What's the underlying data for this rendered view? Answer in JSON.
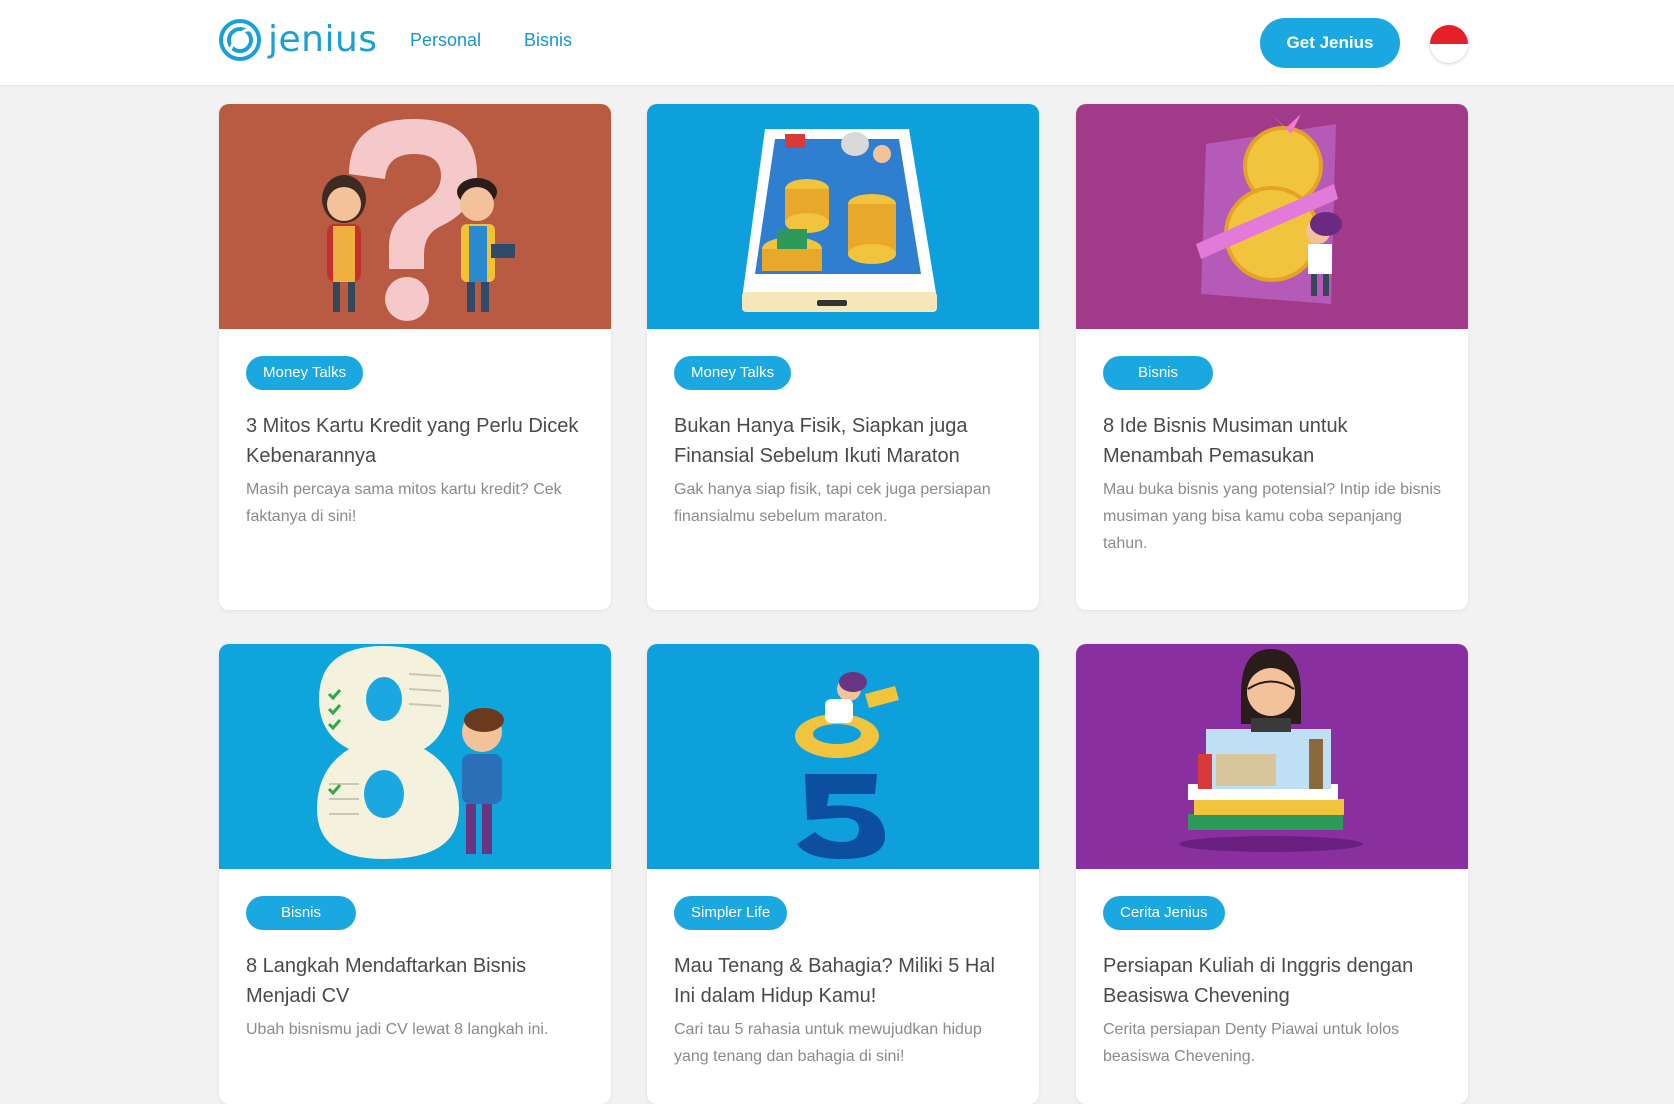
{
  "header": {
    "logo_text": "jenius",
    "nav": {
      "personal": "Personal",
      "bisnis": "Bisnis"
    },
    "cta_label": "Get Jenius",
    "language_flag": "indonesia-flag"
  },
  "colors": {
    "accent": "#1ba7df",
    "card1_bg": "#b95a42",
    "card2_bg": "#0ea0dc",
    "card3_bg": "#a23a8a",
    "card4_bg": "#0ea5dc",
    "card5_bg": "#0ea0dc",
    "card6_bg": "#8a2fa0"
  },
  "cards": [
    {
      "tag": "Money Talks",
      "title": "3 Mitos Kartu Kredit yang Perlu Dicek Kebenarannya",
      "description": "Masih percaya sama mitos kartu kredit? Cek faktanya di sini!"
    },
    {
      "tag": "Money Talks",
      "title": "Bukan Hanya Fisik, Siapkan juga Finansial Sebelum Ikuti Maraton",
      "description": "Gak hanya siap fisik, tapi cek juga persiapan finansialmu sebelum maraton."
    },
    {
      "tag": "Bisnis",
      "title": "8 Ide Bisnis Musiman untuk Menambah Pemasukan",
      "description": "Mau buka bisnis yang potensial? Intip ide bisnis musiman yang bisa kamu coba sepanjang tahun."
    },
    {
      "tag": "Bisnis",
      "title": "8 Langkah Mendaftarkan Bisnis Menjadi CV",
      "description": "Ubah bisnismu jadi CV lewat 8 langkah ini."
    },
    {
      "tag": "Simpler Life",
      "title": "Mau Tenang & Bahagia? Miliki 5 Hal Ini dalam Hidup Kamu!",
      "description": "Cari tau 5 rahasia untuk mewujudkan hidup yang tenang dan bahagia di sini!"
    },
    {
      "tag": "Cerita Jenius",
      "title": "Persiapan Kuliah di Inggris dengan Beasiswa Chevening",
      "description": "Cerita persiapan Denty Piawai untuk lolos beasiswa Chevening."
    }
  ]
}
